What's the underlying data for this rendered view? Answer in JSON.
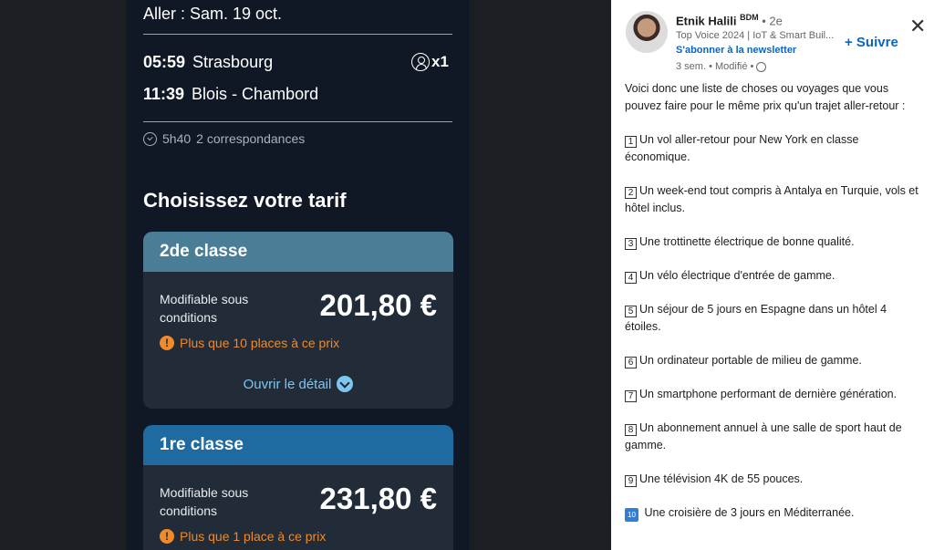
{
  "trip": {
    "date": "Aller : Sam. 19 oct.",
    "departure_time": "05:59",
    "departure_city": "Strasbourg",
    "arrival_time": "11:39",
    "arrival_city": "Blois - Chambord",
    "passengers": "x1",
    "duration": "5h40",
    "connections": "2 correspondances"
  },
  "fares": {
    "heading": "Choisissez votre tarif",
    "cards": [
      {
        "class": "2de classe",
        "condition": "Modifiable sous conditions",
        "price": "201,80 €",
        "warning": "Plus que 10 places à ce prix",
        "detail": "Ouvrir le détail",
        "header_color": "#4a7e96"
      },
      {
        "class": "1re classe",
        "condition": "Modifiable sous conditions",
        "price": "231,80 €",
        "warning": "Plus que 1 place à ce prix",
        "header_color": "#1f6aa0"
      }
    ]
  },
  "post": {
    "author_name": "Etnik Halili",
    "author_badge": "BDM",
    "degree": "• 2e",
    "subtitle": "Top Voice 2024 | IoT & Smart Buil...",
    "newsletter": "S'abonner à la newsletter",
    "meta": "3 sem. • Modifié •",
    "follow": "+ Suivre",
    "intro": "Voici donc une liste de choses ou voyages que vous pouvez faire pour le même prix qu'un trajet aller-retour :",
    "items": [
      {
        "n": "1",
        "text": "Un vol aller-retour pour New York en classe économique."
      },
      {
        "n": "2",
        "text": "Un week-end tout compris à Antalya en Turquie, vols et hôtel inclus."
      },
      {
        "n": "3",
        "text": "Une trottinette électrique de bonne qualité."
      },
      {
        "n": "4",
        "text": "Un vélo électrique d'entrée de gamme."
      },
      {
        "n": "5",
        "text": "Un séjour de 5 jours en Espagne dans un hôtel 4 étoiles."
      },
      {
        "n": "6",
        "text": "Un ordinateur portable de milieu de gamme."
      },
      {
        "n": "7",
        "text": "Un smartphone performant de dernière génération."
      },
      {
        "n": "8",
        "text": "Un abonnement annuel à une salle de sport haut de gamme."
      },
      {
        "n": "9",
        "text": "Une télévision 4K de 55 pouces."
      },
      {
        "n": "10",
        "text": "Une croisière de 3 jours en Méditerranée."
      }
    ]
  }
}
